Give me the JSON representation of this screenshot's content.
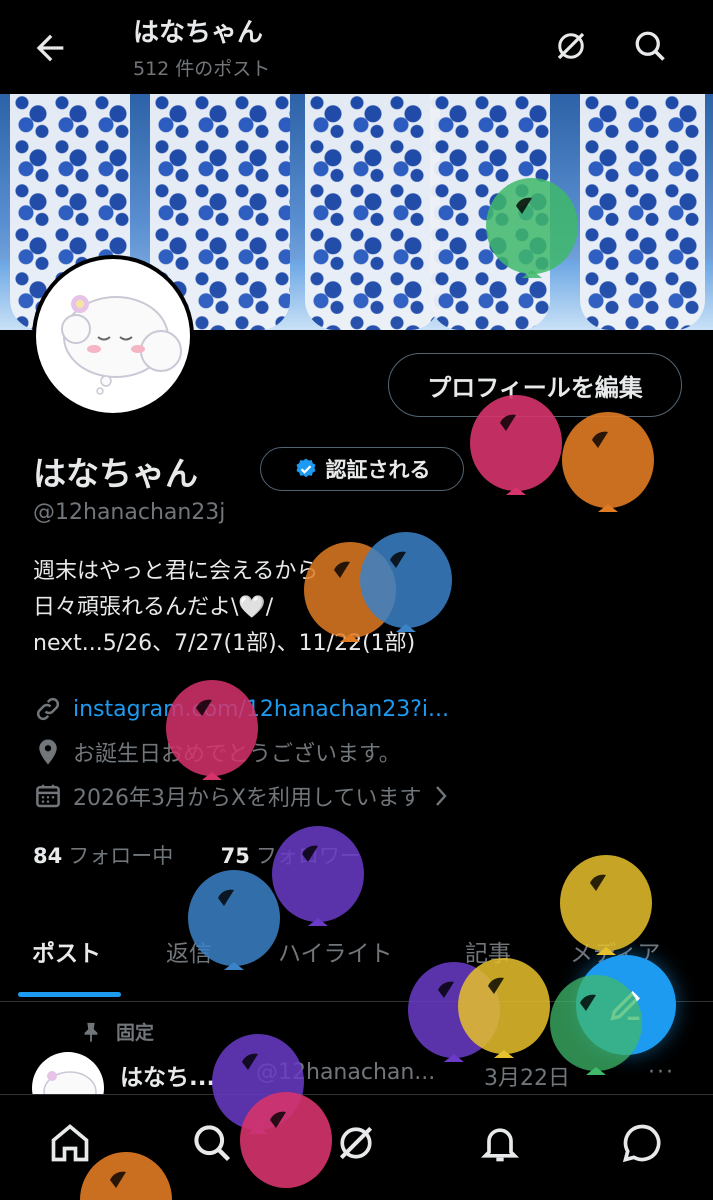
{
  "header": {
    "title": "はなちゃん",
    "post_count": "512 件のポスト"
  },
  "profile": {
    "edit_button": "プロフィールを編集",
    "name": "はなちゃん",
    "verify_button": "認証される",
    "handle": "@12hanachan23j",
    "bio": "週末はやっと君に会えるから\n日々頑張れるんだよ\\🤍/\nnext...5/26、7/27(1部)、11/22(1部)",
    "link": "instagram.com/12hanachan23?i...",
    "location": "お誕生日おめでとうございます。",
    "joined": "2026年3月からXを利用しています",
    "following_count": "84",
    "following_label": "フォロー中",
    "followers_count": "75",
    "followers_label": "フォロワー"
  },
  "tabs": [
    {
      "label": "ポスト",
      "active": true
    },
    {
      "label": "返信"
    },
    {
      "label": "ハイライト"
    },
    {
      "label": "記事"
    },
    {
      "label": "メディア"
    }
  ],
  "pinned_post": {
    "pinned_label": "固定",
    "name": "はなち...",
    "handle": "@12hanachan...",
    "date": "3月22日",
    "more": "···"
  },
  "colors": {
    "accent": "#1d9bf0",
    "balloons": [
      "#3fb86a",
      "#d6336c",
      "#e07b24",
      "#3b83c8",
      "#6a3bc8",
      "#e7c12d"
    ]
  },
  "icons": {
    "back": "arrow-left-icon",
    "grok": "grok-icon",
    "search": "search-icon",
    "verified": "verified-badge-icon",
    "link": "link-icon",
    "location": "location-pin-icon",
    "calendar": "calendar-icon",
    "pin": "pin-icon",
    "compose": "compose-icon",
    "nav": [
      "home-icon",
      "search-icon",
      "grok-icon",
      "bell-icon",
      "message-icon"
    ]
  }
}
